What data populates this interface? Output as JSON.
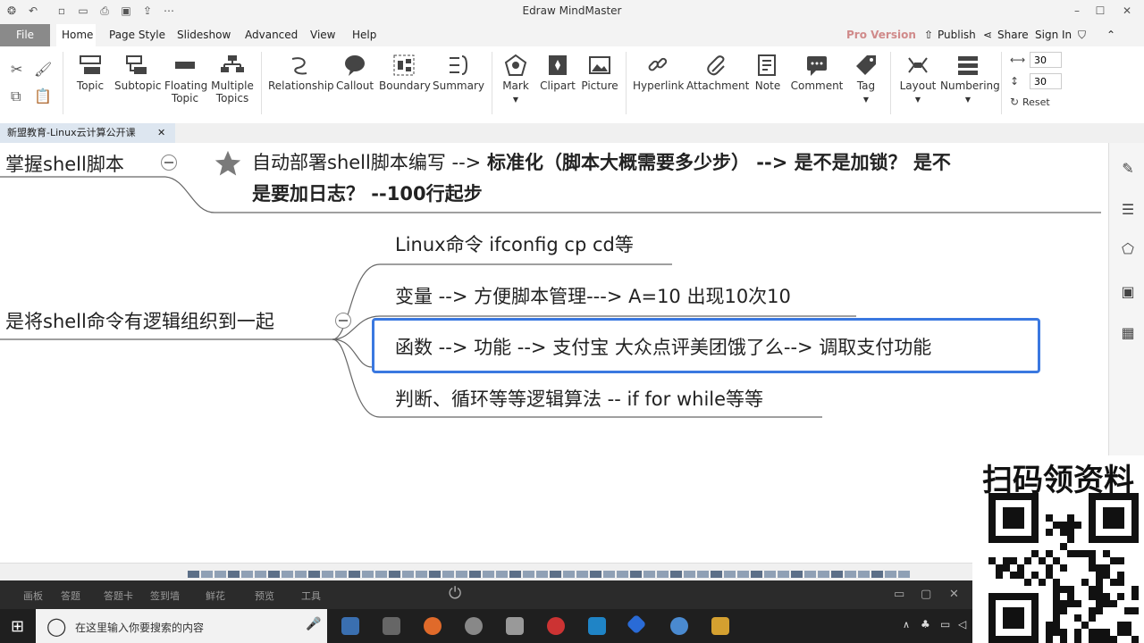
{
  "app": {
    "title": "Edraw MindMaster"
  },
  "menu": {
    "file": "File",
    "items": [
      "Home",
      "Page Style",
      "Slideshow",
      "Advanced",
      "View",
      "Help"
    ],
    "pro": "Pro Version",
    "publish": "Publish",
    "share": "Share",
    "signin": "Sign In"
  },
  "ribbon": {
    "topic": "Topic",
    "subtopic": "Subtopic",
    "floating": [
      "Floating",
      "Topic"
    ],
    "multiple": [
      "Multiple",
      "Topics"
    ],
    "relationship": "Relationship",
    "callout": "Callout",
    "boundary": "Boundary",
    "summary": "Summary",
    "mark": "Mark",
    "clipart": "Clipart",
    "picture": "Picture",
    "hyperlink": "Hyperlink",
    "attachment": "Attachment",
    "note": "Note",
    "comment": "Comment",
    "tag": "Tag",
    "layout": "Layout",
    "numbering": "Numbering",
    "width_value": "30",
    "height_value": "30",
    "reset": "Reset"
  },
  "doc_tab": {
    "label": "新盟教育-Linux云计算公开课"
  },
  "mindmap": {
    "top_topic": "掌握shell脚本",
    "callout_line1_a": "自动部署shell脚本编写 -->",
    "callout_line1_b": "标准化（脚本大概需要多少步） --> 是不是加锁？ 是不",
    "callout_line2": "是要加日志？ --100行起步",
    "main_topic": "是将shell命令有逻辑组织到一起",
    "subtopics": [
      "Linux命令 ifconfig  cp cd等",
      "变量 --> 方便脚本管理---> A=10  出现10次10",
      "函数 --> 功能 -->  支付宝 大众点评美团饿了么--> 调取支付功能",
      "判断、循环等等逻辑算法 -- if for while等等"
    ]
  },
  "bottom_apps": [
    "画板",
    "答题",
    "答题卡",
    "签到墙",
    "鲜花",
    "预览",
    "工具"
  ],
  "taskbar": {
    "search_placeholder": "在这里输入你要搜索的内容"
  },
  "qr": {
    "title": "扫码领资料"
  }
}
